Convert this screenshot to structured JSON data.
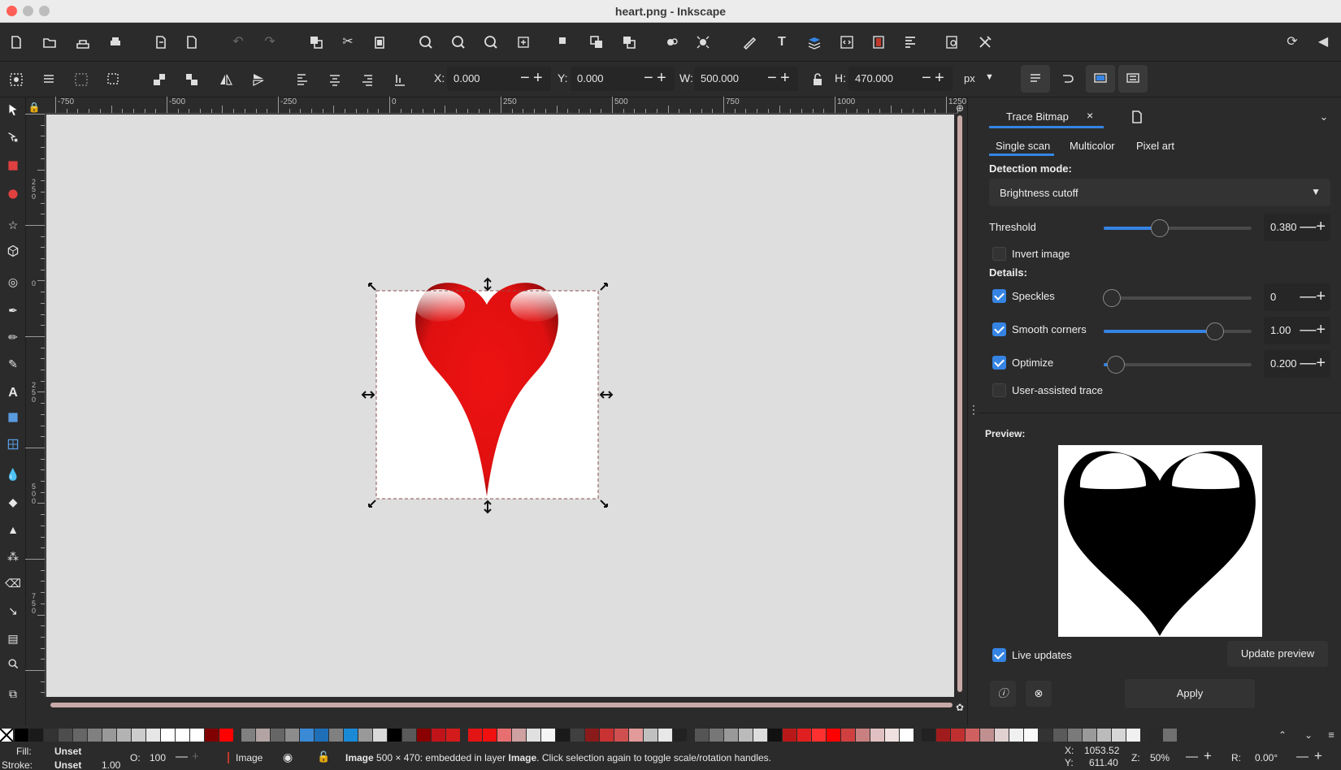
{
  "window": {
    "title": "heart.png - Inkscape"
  },
  "controls": {
    "x_label": "X:",
    "x_value": "0.000",
    "y_label": "Y:",
    "y_value": "0.000",
    "w_label": "W:",
    "w_value": "500.000",
    "h_label": "H:",
    "h_value": "470.000",
    "unit": "px"
  },
  "ruler": {
    "h_labels": [
      "-750",
      "-500",
      "-250",
      "0",
      "250",
      "500",
      "750",
      "1000",
      "1250"
    ],
    "v_labels": [
      "2\n5\n0",
      "0",
      "2\n5\n0",
      "5\n0\n0",
      "7\n5\n0"
    ]
  },
  "panel": {
    "tab_label": "Trace Bitmap",
    "subtabs": [
      "Single scan",
      "Multicolor",
      "Pixel art"
    ],
    "detection_label": "Detection mode:",
    "detection_value": "Brightness cutoff",
    "threshold_label": "Threshold",
    "threshold_value": "0.380",
    "threshold_level": 0.38,
    "invert_label": "Invert image",
    "details_label": "Details:",
    "speckles_label": "Speckles",
    "speckles_value": "0",
    "speckles_level": 0.0,
    "smooth_label": "Smooth corners",
    "smooth_value": "1.00",
    "smooth_level": 0.75,
    "optimize_label": "Optimize",
    "optimize_value": "0.200",
    "optimize_level": 0.04,
    "user_assisted_label": "User-assisted trace",
    "preview_label": "Preview:",
    "live_updates_label": "Live updates",
    "update_preview_label": "Update preview",
    "apply_label": "Apply"
  },
  "status": {
    "fill_label": "Fill:",
    "fill_value": "Unset",
    "stroke_label": "Stroke:",
    "stroke_value": "Unset",
    "stroke_width": "1.00",
    "opacity_label": "O:",
    "opacity_value": "100",
    "layer_name": "Image",
    "message_bold": "Image",
    "message": " 500 × 470: embedded in layer ",
    "message_layer": "Image",
    "message_end": ". Click selection again to toggle scale/rotation handles.",
    "coord_x_label": "X:",
    "coord_x": "1053.52",
    "coord_y_label": "Y:",
    "coord_y": "611.40",
    "zoom_label": "Z:",
    "zoom_value": "50%",
    "rotate_label": "R:",
    "rotate_value": "0.00°"
  },
  "colors": {
    "accent": "#3584e4",
    "heart_red": "#e31414",
    "scrollbar": "#c7aaa7"
  },
  "palette": [
    "#000000",
    "#1a1a1a",
    "#333333",
    "#4d4d4d",
    "#666666",
    "#808080",
    "#999999",
    "#b3b3b3",
    "#cccccc",
    "#e6e6e6",
    "#ffffff",
    "#ffffff",
    "#ffffff",
    "#800000",
    "#ff0000",
    "#808080",
    "#b3a3a3",
    "#666666",
    "#8c8c8c",
    "#3a8ad6",
    "#1e6fb8",
    "#808080",
    "#1a8ad6",
    "#999999",
    "#d9d9d9",
    "#000000",
    "#5a5a5a",
    "#8b0000",
    "#c0141a",
    "#d41b1b",
    "#e31414",
    "#f01010",
    "#e86f6f",
    "#cfa0a0",
    "#e0e0e0",
    "#f5f5f5",
    "#1a1a1a",
    "#404040",
    "#8b1a1a",
    "#c83232",
    "#d05050",
    "#e39a9a",
    "#c0c0c0",
    "#e8e8e8",
    "#222222",
    "#555555",
    "#777777",
    "#999999",
    "#bbbbbb",
    "#dddddd",
    "#111111",
    "#b81818",
    "#e02020",
    "#ff3030",
    "#ff0000",
    "#d04040",
    "#c88080",
    "#e0c0c0",
    "#f0e0e0",
    "#ffffff",
    "#222222",
    "#a01c1c",
    "#c03030",
    "#d06060",
    "#c09090",
    "#e0d0d0",
    "#f0f0f0",
    "#fafafa",
    "#333333",
    "#5a5a5a",
    "#7a7a7a",
    "#9a9a9a",
    "#bbbbbb",
    "#d6d6d6",
    "#f0f0f0",
    "#2a2a2a",
    "#707070"
  ]
}
